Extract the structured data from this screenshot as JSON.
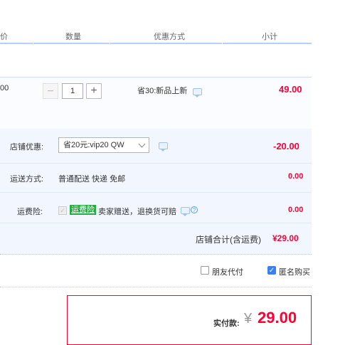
{
  "header": {
    "col_price_fragment": "价",
    "col_qty": "数量",
    "col_promo": "优惠方式",
    "col_subtotal": "小计"
  },
  "item": {
    "price_fragment": "00",
    "qty_minus": "−",
    "quantity": "1",
    "qty_plus": "+",
    "promo": "省30:新品上新",
    "subtotal": "49.00"
  },
  "shop": {
    "discount_label": "店铺优惠:",
    "discount_select": "省20元:vip20 QW",
    "discount_amount": "-20.00",
    "shipping_label": "运送方式:",
    "shipping_method": "普通配送 快递 免邮",
    "shipping_amount": "0.00",
    "insurance_label": "运费险:",
    "insurance_tag": "运费险",
    "insurance_desc": "卖家赠送，退换货可赔",
    "insurance_amount": "0.00",
    "total_label": "店铺合计(含运费)",
    "total_amount": "¥29.00"
  },
  "options": {
    "friend_pay": "朋友代付",
    "anonymous": "匿名购买",
    "anonymous_checked": true
  },
  "payment": {
    "label": "实付款:",
    "currency": "¥",
    "amount": "29.00"
  },
  "colors": {
    "accent_red": "#ff0036",
    "accent_blue": "#3b80f0",
    "tag_green": "#27a943"
  }
}
